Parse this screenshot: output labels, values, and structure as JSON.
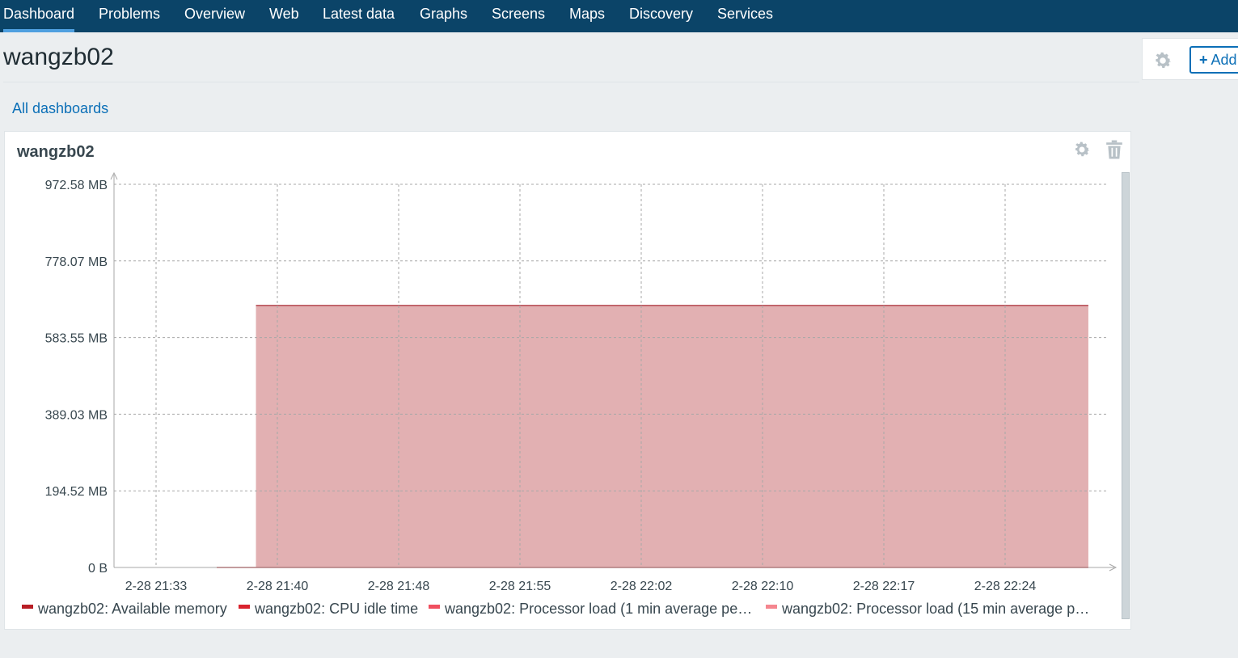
{
  "nav": {
    "items": [
      {
        "label": "Dashboard",
        "active": true
      },
      {
        "label": "Problems"
      },
      {
        "label": "Overview"
      },
      {
        "label": "Web"
      },
      {
        "label": "Latest data"
      },
      {
        "label": "Graphs"
      },
      {
        "label": "Screens"
      },
      {
        "label": "Maps"
      },
      {
        "label": "Discovery"
      },
      {
        "label": "Services"
      }
    ]
  },
  "page": {
    "title": "wangzb02",
    "add_label": "Add",
    "breadcrumb": "All dashboards"
  },
  "widget": {
    "title": "wangzb02"
  },
  "colors": {
    "nav_bg": "#0b4468",
    "link": "#0b6fb7",
    "area_fill": "#e2b0b2",
    "area_line": "#b5474f"
  },
  "chart_data": {
    "type": "area",
    "y_ticks": [
      "972.58 MB",
      "778.07 MB",
      "583.55 MB",
      "389.03 MB",
      "194.52 MB",
      "0 B"
    ],
    "x_ticks": [
      "2-28 21:33",
      "2-28 21:40",
      "2-28 21:48",
      "2-28 21:55",
      "2-28 22:02",
      "2-28 22:10",
      "2-28 22:17",
      "2-28 22:24"
    ],
    "ylim": [
      0,
      972.58
    ],
    "grid": true,
    "legend_position": "bottom",
    "series": [
      {
        "name": "wangzb02: Available memory",
        "color": "#b81e25",
        "x_start": "2-28 21:39",
        "x_end": "2-28 22:29",
        "value": 665
      },
      {
        "name": "wangzb02: CPU idle time",
        "color": "#d9232e"
      },
      {
        "name": "wangzb02: Processor load (1 min average pe…",
        "color": "#f04f5f"
      },
      {
        "name": "wangzb02: Processor load (15 min average p…",
        "color": "#f5868f"
      }
    ]
  }
}
